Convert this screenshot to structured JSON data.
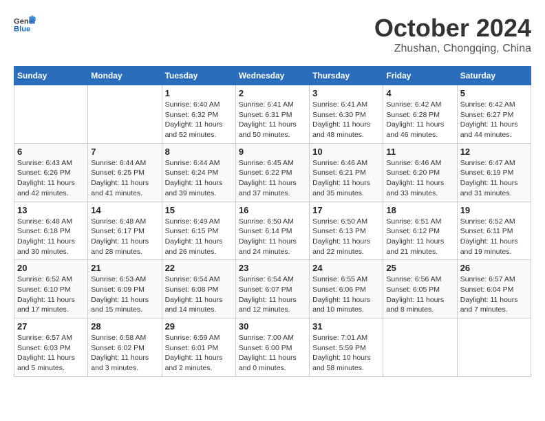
{
  "logo": {
    "line1": "General",
    "line2": "Blue"
  },
  "header": {
    "month": "October 2024",
    "location": "Zhushan, Chongqing, China"
  },
  "weekdays": [
    "Sunday",
    "Monday",
    "Tuesday",
    "Wednesday",
    "Thursday",
    "Friday",
    "Saturday"
  ],
  "weeks": [
    [
      {
        "day": "",
        "info": ""
      },
      {
        "day": "",
        "info": ""
      },
      {
        "day": "1",
        "info": "Sunrise: 6:40 AM\nSunset: 6:32 PM\nDaylight: 11 hours and 52 minutes."
      },
      {
        "day": "2",
        "info": "Sunrise: 6:41 AM\nSunset: 6:31 PM\nDaylight: 11 hours and 50 minutes."
      },
      {
        "day": "3",
        "info": "Sunrise: 6:41 AM\nSunset: 6:30 PM\nDaylight: 11 hours and 48 minutes."
      },
      {
        "day": "4",
        "info": "Sunrise: 6:42 AM\nSunset: 6:28 PM\nDaylight: 11 hours and 46 minutes."
      },
      {
        "day": "5",
        "info": "Sunrise: 6:42 AM\nSunset: 6:27 PM\nDaylight: 11 hours and 44 minutes."
      }
    ],
    [
      {
        "day": "6",
        "info": "Sunrise: 6:43 AM\nSunset: 6:26 PM\nDaylight: 11 hours and 42 minutes."
      },
      {
        "day": "7",
        "info": "Sunrise: 6:44 AM\nSunset: 6:25 PM\nDaylight: 11 hours and 41 minutes."
      },
      {
        "day": "8",
        "info": "Sunrise: 6:44 AM\nSunset: 6:24 PM\nDaylight: 11 hours and 39 minutes."
      },
      {
        "day": "9",
        "info": "Sunrise: 6:45 AM\nSunset: 6:22 PM\nDaylight: 11 hours and 37 minutes."
      },
      {
        "day": "10",
        "info": "Sunrise: 6:46 AM\nSunset: 6:21 PM\nDaylight: 11 hours and 35 minutes."
      },
      {
        "day": "11",
        "info": "Sunrise: 6:46 AM\nSunset: 6:20 PM\nDaylight: 11 hours and 33 minutes."
      },
      {
        "day": "12",
        "info": "Sunrise: 6:47 AM\nSunset: 6:19 PM\nDaylight: 11 hours and 31 minutes."
      }
    ],
    [
      {
        "day": "13",
        "info": "Sunrise: 6:48 AM\nSunset: 6:18 PM\nDaylight: 11 hours and 30 minutes."
      },
      {
        "day": "14",
        "info": "Sunrise: 6:48 AM\nSunset: 6:17 PM\nDaylight: 11 hours and 28 minutes."
      },
      {
        "day": "15",
        "info": "Sunrise: 6:49 AM\nSunset: 6:15 PM\nDaylight: 11 hours and 26 minutes."
      },
      {
        "day": "16",
        "info": "Sunrise: 6:50 AM\nSunset: 6:14 PM\nDaylight: 11 hours and 24 minutes."
      },
      {
        "day": "17",
        "info": "Sunrise: 6:50 AM\nSunset: 6:13 PM\nDaylight: 11 hours and 22 minutes."
      },
      {
        "day": "18",
        "info": "Sunrise: 6:51 AM\nSunset: 6:12 PM\nDaylight: 11 hours and 21 minutes."
      },
      {
        "day": "19",
        "info": "Sunrise: 6:52 AM\nSunset: 6:11 PM\nDaylight: 11 hours and 19 minutes."
      }
    ],
    [
      {
        "day": "20",
        "info": "Sunrise: 6:52 AM\nSunset: 6:10 PM\nDaylight: 11 hours and 17 minutes."
      },
      {
        "day": "21",
        "info": "Sunrise: 6:53 AM\nSunset: 6:09 PM\nDaylight: 11 hours and 15 minutes."
      },
      {
        "day": "22",
        "info": "Sunrise: 6:54 AM\nSunset: 6:08 PM\nDaylight: 11 hours and 14 minutes."
      },
      {
        "day": "23",
        "info": "Sunrise: 6:54 AM\nSunset: 6:07 PM\nDaylight: 11 hours and 12 minutes."
      },
      {
        "day": "24",
        "info": "Sunrise: 6:55 AM\nSunset: 6:06 PM\nDaylight: 11 hours and 10 minutes."
      },
      {
        "day": "25",
        "info": "Sunrise: 6:56 AM\nSunset: 6:05 PM\nDaylight: 11 hours and 8 minutes."
      },
      {
        "day": "26",
        "info": "Sunrise: 6:57 AM\nSunset: 6:04 PM\nDaylight: 11 hours and 7 minutes."
      }
    ],
    [
      {
        "day": "27",
        "info": "Sunrise: 6:57 AM\nSunset: 6:03 PM\nDaylight: 11 hours and 5 minutes."
      },
      {
        "day": "28",
        "info": "Sunrise: 6:58 AM\nSunset: 6:02 PM\nDaylight: 11 hours and 3 minutes."
      },
      {
        "day": "29",
        "info": "Sunrise: 6:59 AM\nSunset: 6:01 PM\nDaylight: 11 hours and 2 minutes."
      },
      {
        "day": "30",
        "info": "Sunrise: 7:00 AM\nSunset: 6:00 PM\nDaylight: 11 hours and 0 minutes."
      },
      {
        "day": "31",
        "info": "Sunrise: 7:01 AM\nSunset: 5:59 PM\nDaylight: 10 hours and 58 minutes."
      },
      {
        "day": "",
        "info": ""
      },
      {
        "day": "",
        "info": ""
      }
    ]
  ]
}
